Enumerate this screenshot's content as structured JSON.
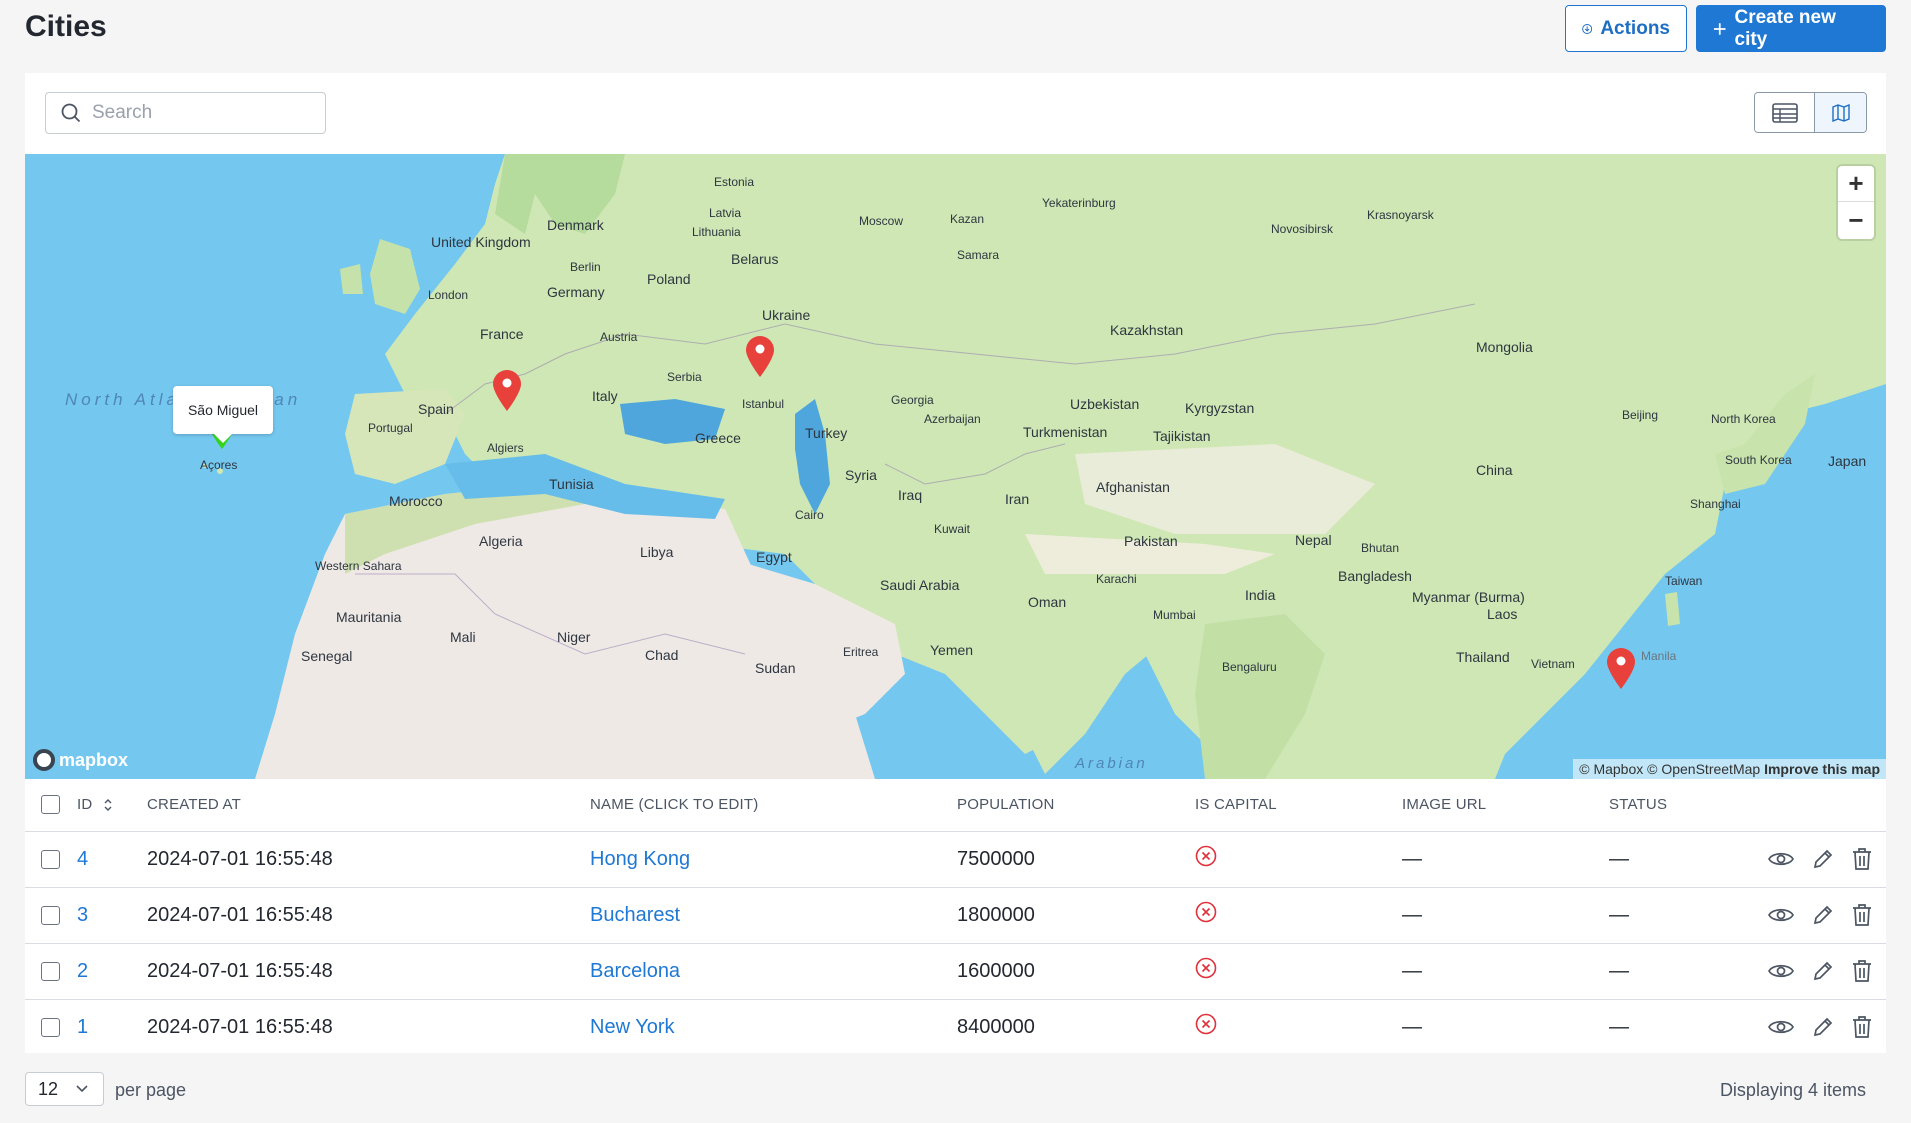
{
  "page": {
    "title": "Cities",
    "actions_label": "Actions",
    "create_label": "Create new city"
  },
  "search": {
    "placeholder": "Search",
    "value": ""
  },
  "map": {
    "popup": "São Miguel",
    "attribution": "© Mapbox © OpenStreetMap",
    "improve": "Improve this map",
    "logo": "mapbox",
    "zoom_in": "+",
    "zoom_out": "−",
    "ocean_label": "North Atlantic Ocean",
    "sea_label": "Arabian",
    "labels": {
      "estonia": "Estonia",
      "latvia": "Latvia",
      "lithuania": "Lithuania",
      "moscow": "Moscow",
      "kazan": "Kazan",
      "yekaterinburg": "Yekaterinburg",
      "krasnoyarsk": "Krasnoyarsk",
      "novosibirsk": "Novosibirsk",
      "samara": "Samara",
      "denmark": "Denmark",
      "united_kingdom": "United Kingdom",
      "london": "London",
      "berlin": "Berlin",
      "poland": "Poland",
      "belarus": "Belarus",
      "germany": "Germany",
      "ukraine": "Ukraine",
      "france": "France",
      "austria": "Austria",
      "kazakhstan": "Kazakhstan",
      "mongolia": "Mongolia",
      "spain": "Spain",
      "portugal": "Portugal",
      "italy": "Italy",
      "serbia": "Serbia",
      "istanbul": "Istanbul",
      "georgia": "Georgia",
      "azerbaijan": "Azerbaijan",
      "uzbekistan": "Uzbekistan",
      "kyrgyzstan": "Kyrgyzstan",
      "turkmenistan": "Turkmenistan",
      "tajikistan": "Tajikistan",
      "beijing": "Beijing",
      "north_korea": "North Korea",
      "south_korea": "South Korea",
      "japan": "Japan",
      "greece": "Greece",
      "turkey": "Turkey",
      "algiers": "Algiers",
      "acores": "Açores",
      "china": "China",
      "tunisia": "Tunisia",
      "syria": "Syria",
      "iraq": "Iraq",
      "afghanistan": "Afghanistan",
      "morocco": "Morocco",
      "cairo": "Cairo",
      "iran": "Iran",
      "shanghai": "Shanghai",
      "kuwait": "Kuwait",
      "algeria": "Algeria",
      "libya": "Libya",
      "egypt": "Egypt",
      "pakistan": "Pakistan",
      "nepal": "Nepal",
      "bhutan": "Bhutan",
      "western_sahara": "Western Sahara",
      "bangladesh": "Bangladesh",
      "saudi_arabia": "Saudi Arabia",
      "karachi": "Karachi",
      "taiwan": "Taiwan",
      "oman": "Oman",
      "india": "India",
      "myanmar": "Myanmar (Burma)",
      "mauritania": "Mauritania",
      "laos": "Laos",
      "mumbai": "Mumbai",
      "mali": "Mali",
      "niger": "Niger",
      "yemen": "Yemen",
      "eritrea": "Eritrea",
      "chad": "Chad",
      "senegal": "Senegal",
      "thailand": "Thailand",
      "sudan": "Sudan",
      "bengaluru": "Bengaluru",
      "vietnam": "Vietnam",
      "manila": "Manila"
    }
  },
  "table": {
    "headers": {
      "id": "ID",
      "created_at": "CREATED AT",
      "name": "NAME (CLICK TO EDIT)",
      "population": "POPULATION",
      "is_capital": "IS CAPITAL",
      "image_url": "IMAGE URL",
      "status": "STATUS"
    },
    "rows": [
      {
        "id": "4",
        "created_at": "2024-07-01 16:55:48",
        "name": "Hong Kong",
        "population": "7500000",
        "image_url": "—",
        "status": "—"
      },
      {
        "id": "3",
        "created_at": "2024-07-01 16:55:48",
        "name": "Bucharest",
        "population": "1800000",
        "image_url": "—",
        "status": "—"
      },
      {
        "id": "2",
        "created_at": "2024-07-01 16:55:48",
        "name": "Barcelona",
        "population": "1600000",
        "image_url": "—",
        "status": "—"
      },
      {
        "id": "1",
        "created_at": "2024-07-01 16:55:48",
        "name": "New York",
        "population": "8400000",
        "image_url": "—",
        "status": "—"
      }
    ]
  },
  "footer": {
    "per_page_value": "12",
    "per_page_label": "per page",
    "displaying": "Displaying 4 items"
  },
  "colors": {
    "accent": "#1e78d4",
    "marker_red": "#e8403b",
    "marker_green": "#35d21e",
    "capital_false": "#e0303a",
    "water": "#74c7ee",
    "land": "#cfe7b4"
  }
}
